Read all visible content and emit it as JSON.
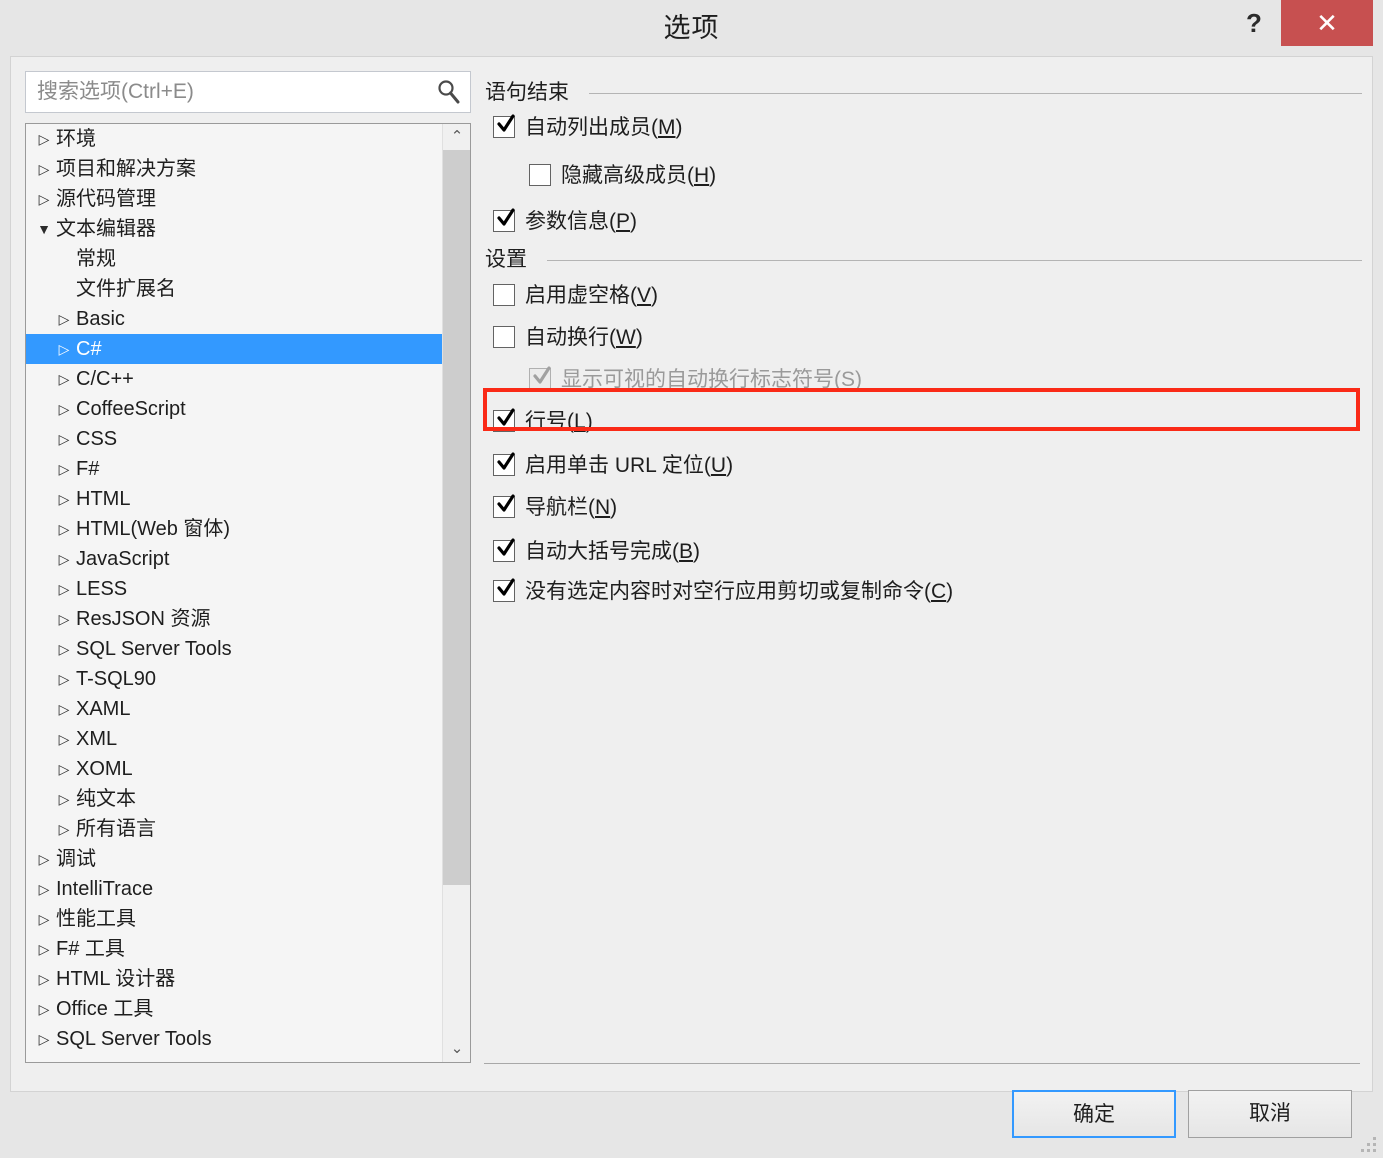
{
  "window": {
    "title": "选项",
    "help_label": "?",
    "close_label": "✕"
  },
  "search": {
    "placeholder": "搜索选项(Ctrl+E)",
    "value": ""
  },
  "tree": {
    "items": [
      {
        "label": "环境",
        "level": 0,
        "arrow": "▷",
        "selected": false
      },
      {
        "label": "项目和解决方案",
        "level": 0,
        "arrow": "▷",
        "selected": false
      },
      {
        "label": "源代码管理",
        "level": 0,
        "arrow": "▷",
        "selected": false
      },
      {
        "label": "文本编辑器",
        "level": 0,
        "arrow": "◢",
        "selected": false
      },
      {
        "label": "常规",
        "level": 1,
        "arrow": "",
        "selected": false
      },
      {
        "label": "文件扩展名",
        "level": 1,
        "arrow": "",
        "selected": false
      },
      {
        "label": "Basic",
        "level": 1,
        "arrow": "▷",
        "selected": false
      },
      {
        "label": "C#",
        "level": 1,
        "arrow": "▷",
        "selected": true
      },
      {
        "label": "C/C++",
        "level": 1,
        "arrow": "▷",
        "selected": false
      },
      {
        "label": "CoffeeScript",
        "level": 1,
        "arrow": "▷",
        "selected": false
      },
      {
        "label": "CSS",
        "level": 1,
        "arrow": "▷",
        "selected": false
      },
      {
        "label": "F#",
        "level": 1,
        "arrow": "▷",
        "selected": false
      },
      {
        "label": "HTML",
        "level": 1,
        "arrow": "▷",
        "selected": false
      },
      {
        "label": "HTML(Web 窗体)",
        "level": 1,
        "arrow": "▷",
        "selected": false
      },
      {
        "label": "JavaScript",
        "level": 1,
        "arrow": "▷",
        "selected": false
      },
      {
        "label": "LESS",
        "level": 1,
        "arrow": "▷",
        "selected": false
      },
      {
        "label": "ResJSON 资源",
        "level": 1,
        "arrow": "▷",
        "selected": false
      },
      {
        "label": "SQL Server Tools",
        "level": 1,
        "arrow": "▷",
        "selected": false
      },
      {
        "label": "T-SQL90",
        "level": 1,
        "arrow": "▷",
        "selected": false
      },
      {
        "label": "XAML",
        "level": 1,
        "arrow": "▷",
        "selected": false
      },
      {
        "label": "XML",
        "level": 1,
        "arrow": "▷",
        "selected": false
      },
      {
        "label": "XOML",
        "level": 1,
        "arrow": "▷",
        "selected": false
      },
      {
        "label": "纯文本",
        "level": 1,
        "arrow": "▷",
        "selected": false
      },
      {
        "label": "所有语言",
        "level": 1,
        "arrow": "▷",
        "selected": false
      },
      {
        "label": "调试",
        "level": 0,
        "arrow": "▷",
        "selected": false
      },
      {
        "label": "IntelliTrace",
        "level": 0,
        "arrow": "▷",
        "selected": false
      },
      {
        "label": "性能工具",
        "level": 0,
        "arrow": "▷",
        "selected": false
      },
      {
        "label": "F# 工具",
        "level": 0,
        "arrow": "▷",
        "selected": false
      },
      {
        "label": "HTML 设计器",
        "level": 0,
        "arrow": "▷",
        "selected": false
      },
      {
        "label": "Office 工具",
        "level": 0,
        "arrow": "▷",
        "selected": false
      },
      {
        "label": "SQL Server Tools",
        "level": 0,
        "arrow": "▷",
        "selected": false
      }
    ],
    "scrollbar": {
      "up_arrow": "⌃",
      "down_arrow": "⌄"
    }
  },
  "sections": [
    {
      "title": "语句结束",
      "options": [
        {
          "label": "自动列出成员(",
          "accel": "M",
          "tail": ")",
          "checked": true,
          "enabled": true,
          "indent": 0
        },
        {
          "label": "隐藏高级成员(",
          "accel": "H",
          "tail": ")",
          "checked": false,
          "enabled": true,
          "indent": 1
        },
        {
          "label": "参数信息(",
          "accel": "P",
          "tail": ")",
          "checked": true,
          "enabled": true,
          "indent": 0
        }
      ]
    },
    {
      "title": "设置",
      "options": [
        {
          "label": "启用虚空格(",
          "accel": "V",
          "tail": ")",
          "checked": false,
          "enabled": true,
          "indent": 0
        },
        {
          "label": "自动换行(",
          "accel": "W",
          "tail": ")",
          "checked": false,
          "enabled": true,
          "indent": 0
        },
        {
          "label": "显示可视的自动换行标志符号(",
          "accel": "S",
          "tail": ")",
          "checked": true,
          "enabled": false,
          "indent": 1
        },
        {
          "label": "行号(",
          "accel": "L",
          "tail": ")",
          "checked": true,
          "enabled": true,
          "indent": 0,
          "highlighted": true
        },
        {
          "label": "启用单击 URL 定位(",
          "accel": "U",
          "tail": ")",
          "checked": true,
          "enabled": true,
          "indent": 0
        },
        {
          "label": "导航栏(",
          "accel": "N",
          "tail": ")",
          "checked": true,
          "enabled": true,
          "indent": 0
        },
        {
          "label": "自动大括号完成(",
          "accel": "B",
          "tail": ")",
          "checked": true,
          "enabled": true,
          "indent": 0
        },
        {
          "label": "没有选定内容时对空行应用剪切或复制命令(",
          "accel": "C",
          "tail": ")",
          "checked": true,
          "enabled": true,
          "indent": 0
        }
      ]
    }
  ],
  "footer": {
    "ok_label": "确定",
    "cancel_label": "取消"
  },
  "colors": {
    "selection_blue": "#3399ff",
    "highlight_red": "#fa2a17",
    "close_red": "#c75050"
  }
}
